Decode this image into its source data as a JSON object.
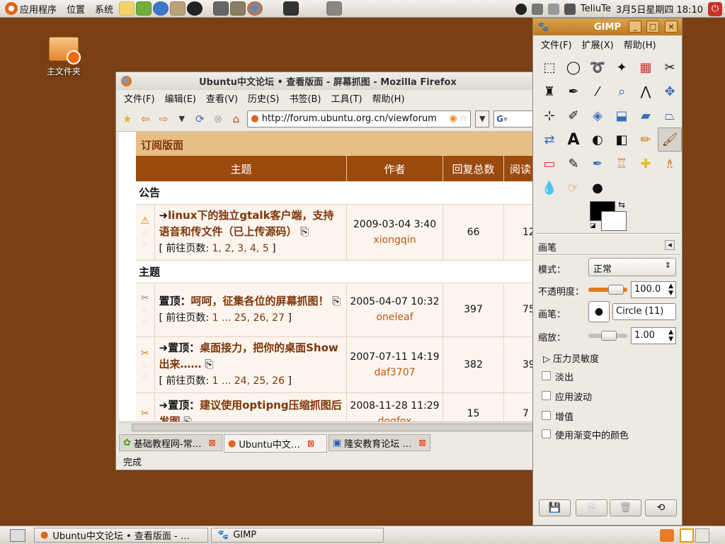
{
  "top_panel": {
    "menu_applications": "应用程序",
    "menu_places": "位置",
    "menu_system": "系统",
    "tray_clock": "3月5日星期四  18:10",
    "tray_user": "TeliuTe"
  },
  "desktop": {
    "home_folder_label": "主文件夹"
  },
  "firefox": {
    "title": "Ubuntu中文论坛 • 查看版面 - 屏幕抓图 - Mozilla Firefox",
    "menu": [
      "文件(F)",
      "编辑(E)",
      "查看(V)",
      "历史(S)",
      "书签(B)",
      "工具(T)",
      "帮助(H)"
    ],
    "url": "http://forum.ubuntu.org.cn/viewforum",
    "search_placeholder": "G",
    "forum": {
      "section_title": "订阅版面",
      "columns": {
        "topic": "主题",
        "author": "作者",
        "replies": "回复总数",
        "views": "阅读"
      },
      "announce_label": "公告",
      "topics_label": "主题",
      "page_prefix": "前往页数:",
      "announcement": {
        "title": "linux下的独立gtalk客户端，支持语音和传文件（已上传源码）",
        "pages": "1, 2, 3, 4, 5",
        "date": "2009-03-04 3:40",
        "author": "xiongqin",
        "replies": "66",
        "views": "12"
      },
      "rows": [
        {
          "prefix": "置顶：",
          "title": "呵呵，征集各位的屏幕抓图！",
          "pages": "1 ... 25, 26, 27",
          "date": "2005-04-07 10:32",
          "author": "oneleaf",
          "replies": "397",
          "views": "75"
        },
        {
          "prefix": "置顶：",
          "title": "桌面接力，把你的桌面Show出来……",
          "pages": "1 ... 24, 25, 26",
          "date": "2007-07-11 14:19",
          "author": "daf3707",
          "replies": "382",
          "views": "39"
        },
        {
          "prefix": "置顶：",
          "title": "建议使用optipng压缩抓图后发图",
          "pages": "",
          "date": "2008-11-28 11:29",
          "author": "dogfox",
          "replies": "15",
          "views": "7"
        }
      ]
    },
    "tabs": [
      {
        "label": "基础教程网-常…",
        "active": false
      },
      {
        "label": "Ubuntu中文…",
        "active": true
      },
      {
        "label": "隆安教育论坛 …",
        "active": false
      }
    ],
    "status": "完成"
  },
  "gimp": {
    "title": "GIMP",
    "menu": [
      "文件(F)",
      "扩展(X)",
      "帮助(H)"
    ],
    "options_title": "画笔",
    "mode_label": "模式：",
    "mode_value": "正常",
    "opacity_label": "不透明度：",
    "opacity_value": "100.0",
    "brush_label": "画笔：",
    "brush_value": "Circle (11)",
    "scale_label": "缩放：",
    "scale_value": "1.00",
    "pressure_label": "压力灵敏度",
    "checks": [
      "淡出",
      "应用波动",
      "增值",
      "使用渐变中的颜色"
    ],
    "accent": "#e07b1a"
  },
  "taskbar": {
    "items": [
      "Ubuntu中文论坛 • 查看版面 - …",
      "GIMP"
    ]
  }
}
